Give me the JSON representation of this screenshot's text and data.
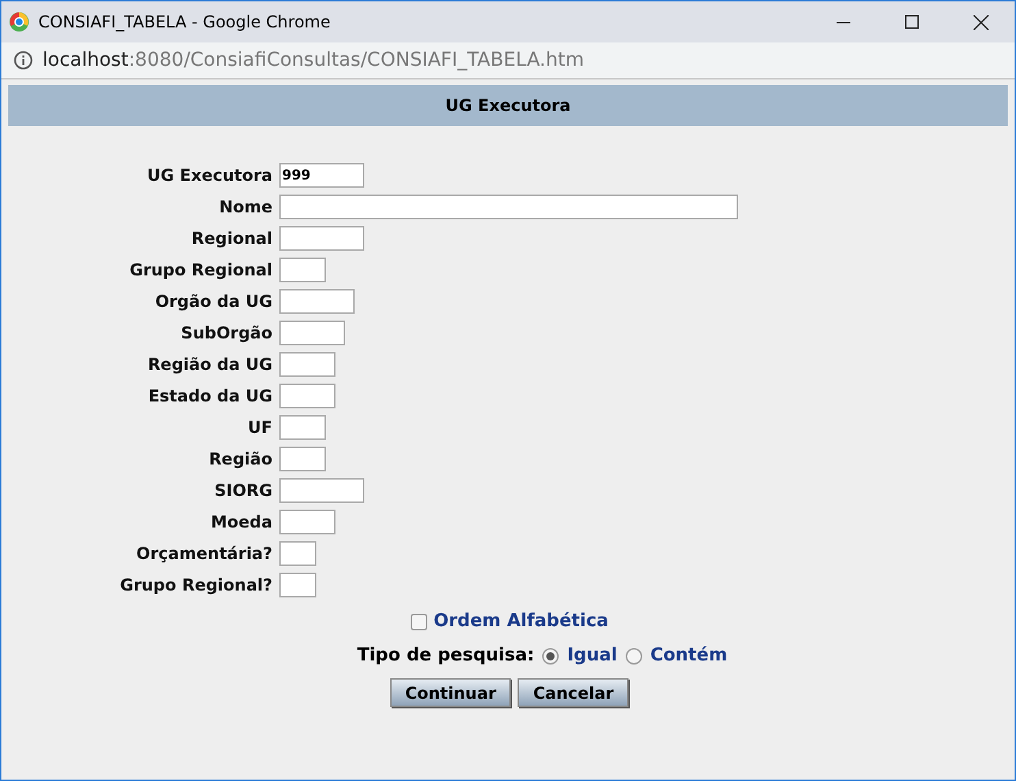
{
  "window": {
    "title": "CONSIAFI_TABELA - Google Chrome"
  },
  "address_bar": {
    "host": "localhost",
    "path": ":8080/ConsiafiConsultas/CONSIAFI_TABELA.htm"
  },
  "header": {
    "title": "UG Executora"
  },
  "fields": [
    {
      "label": "UG Executora",
      "value": "999"
    },
    {
      "label": "Nome"
    },
    {
      "label": "Regional"
    },
    {
      "label": "Grupo Regional"
    },
    {
      "label": "Orgão da UG"
    },
    {
      "label": "SubOrgão"
    },
    {
      "label": "Região da UG"
    },
    {
      "label": "Estado da UG"
    },
    {
      "label": "UF"
    },
    {
      "label": "Região"
    },
    {
      "label": "SIORG"
    },
    {
      "label": "Moeda"
    },
    {
      "label": "Orçamentária?"
    },
    {
      "label": "Grupo Regional?"
    }
  ],
  "order_checkbox": {
    "label": "Ordem Alfabética",
    "checked": false
  },
  "search_type": {
    "label": "Tipo de pesquisa:",
    "options": [
      {
        "label": "Igual",
        "selected": true
      },
      {
        "label": "Contém",
        "selected": false
      }
    ]
  },
  "buttons": [
    "Continuar",
    "Cancelar"
  ]
}
